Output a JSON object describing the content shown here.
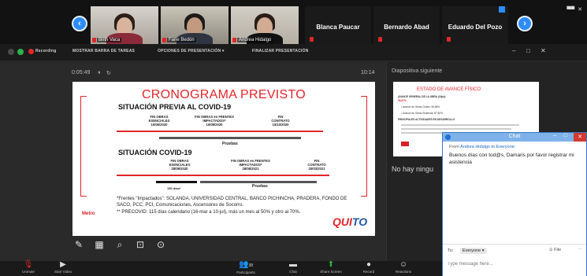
{
  "gallery": {
    "tiles": [
      {
        "name": "Brith Vaca"
      },
      {
        "name": "Fane Bedón"
      },
      {
        "name": "Andrea Hidalgo"
      }
    ],
    "name_tiles": [
      "Blanca Paucar",
      "Bernardo Abad",
      "Eduardo Del Pozo"
    ],
    "prev_icon": "chevron-left-icon",
    "next_icon": "chevron-right-icon"
  },
  "controlbar": {
    "recording": "Recording",
    "show_toolbar": "MOSTRAR BARRA DE TAREAS",
    "presenter_options": "OPCIONES DE PRESENTACIÓN ▾",
    "end_presentation": "FINALIZAR PRESENTACIÓN"
  },
  "presenter": {
    "elapsed": "0:05:49",
    "clock": "10:14"
  },
  "slide": {
    "title": "CRONOGRAMA PREVISTO",
    "section1": "SITUACIÓN PREVIA AL COVID-19",
    "section2": "SITUACIÓN COVID-19",
    "m1": "FIN OBRAS\nESENCIALES\n10/06/2020",
    "m2": "FIN OBRAS en FRENTES\nIMPACTADOS*\n10/08/2020",
    "m3": "FIN\nCONTRATO\n10/10/2020",
    "m4": "FIN OBRAS\nESENCIALES\n28/08/2020",
    "m5": "FIN OBRAS en FRENTES\nIMPACTADOS*\n28/08/2021",
    "m6": "FIN\nCONTRATO\n20/03/2021",
    "pruebas": "Pruebas",
    "dias": "150 días*",
    "note1": "*Frentes \"Impactados\": SOLANDA, UNIVERSIDAD CENTRAL, BANCO PICHINCHA, PRADERA, FONDO DE SACO, PCC, PCI, Comunicaciones,",
    "note2": "Ascensores de Socorro.",
    "note3": "** PRECOVID: 115 días calendario (16-mar a 10-jul), más un mes al 50% y otro al 70%.",
    "logo_metro": "Metro",
    "logo_quito": "QUITO"
  },
  "next": {
    "label": "Diapositiva siguiente",
    "title": "ESTADO DE AVANCE FÍSICO",
    "lines": [
      "AVANCE GENERAL DE LA OBRA (10jul):",
      "93,87%",
      "• Avance de Obras Civiles: 96,86%",
      "• Avance de Obras Sistemas: 87,60%",
      "PRINCIPALES ACTIVIDADES EN DESARROLLO"
    ],
    "no_notes": "No hay ningu"
  },
  "chat": {
    "title": "Chat",
    "from_prefix": "From ",
    "from_name": "Andrea Hidalgo to Everyone:",
    "message": "Buenos días con tod@s, Damaris por favor registrar mi asistencia",
    "to_label": "To:",
    "to_value": "Everyone ▾",
    "file_label": "File",
    "more": "···",
    "placeholder": "Type message here..."
  },
  "meeting_bar": {
    "unmute": "Unmute",
    "start_video": "Start Video",
    "participants": "Participants",
    "participants_count": "38",
    "chat": "Chat",
    "share_screen": "Share Screen",
    "record": "Record",
    "reactions": "Reactions"
  },
  "colors": {
    "accent": "#2d8cff",
    "slide_red": "#e2262b",
    "mute_red": "#e02828"
  }
}
